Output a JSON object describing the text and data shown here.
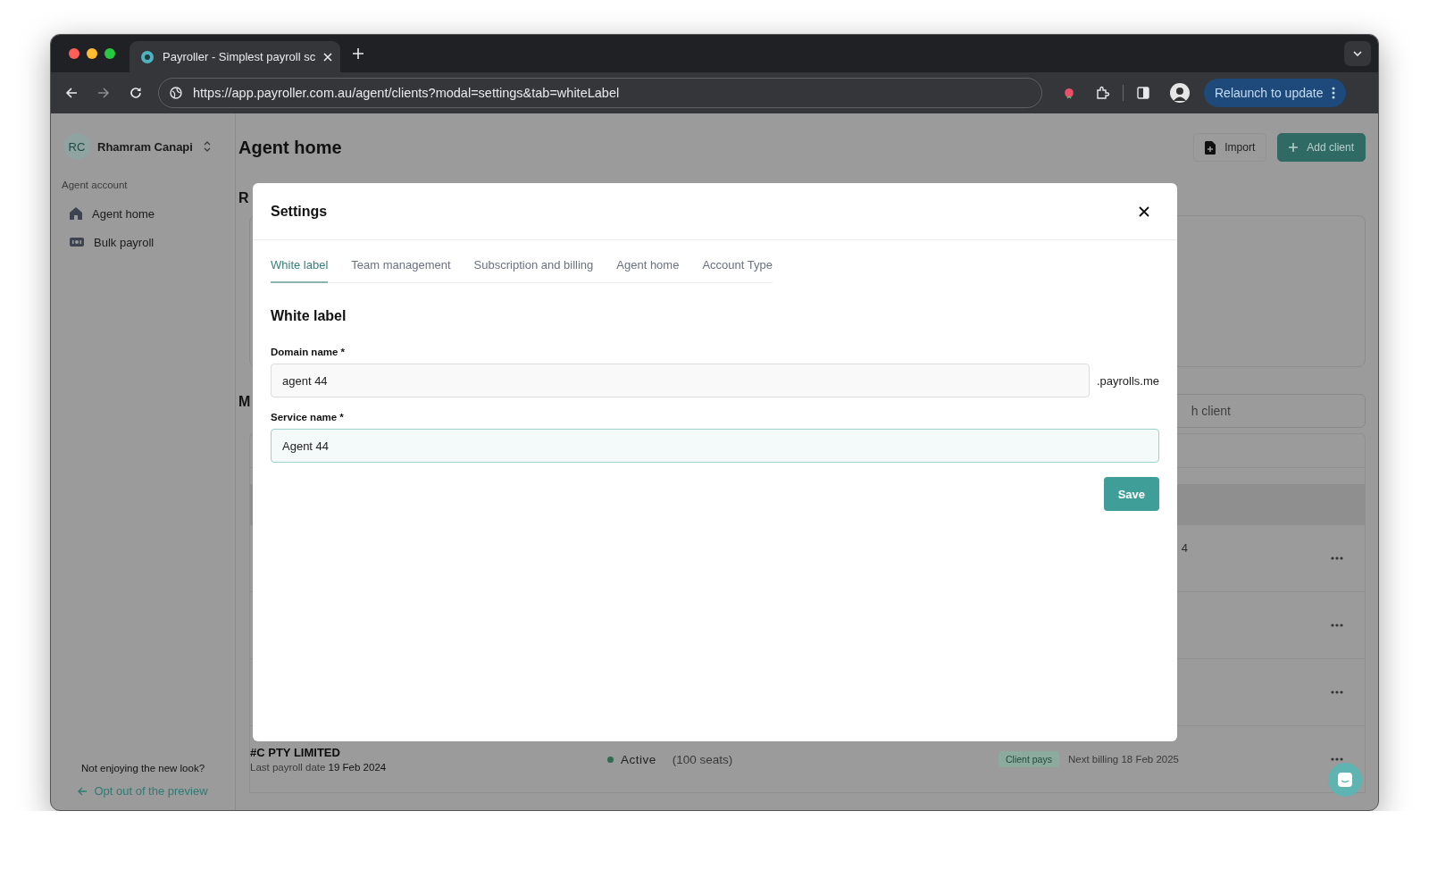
{
  "browser": {
    "tab_title": "Payroller - Simplest payroll sc",
    "url": "https://app.payroller.com.au/agent/clients?modal=settings&tab=whiteLabel",
    "relaunch": "Relaunch to update"
  },
  "sidebar": {
    "initials": "RC",
    "user_name": "Rhamram Canapi",
    "section": "Agent account",
    "items": [
      {
        "kind": "home",
        "label": "Agent home"
      },
      {
        "kind": "payroll",
        "label": "Bulk payroll"
      }
    ],
    "footer_note": "Not enjoying the new look?",
    "opt_out": "Opt out of the preview"
  },
  "page": {
    "title": "Agent home",
    "buttons": [
      {
        "kind": "import",
        "label": "Import"
      },
      {
        "kind": "add",
        "label": "Add client"
      }
    ],
    "section_1_fragment": "R",
    "section_2_fragment": "M",
    "search_fragment": "h client",
    "rows": [
      {
        "kind": "partial",
        "column_fragment": "4"
      },
      {
        "kind": "partial"
      },
      {
        "kind": "partial"
      },
      {
        "kind": "client",
        "name": "#C PTY LIMITED",
        "last_payroll_label": "Last payroll date",
        "last_payroll_date": "19 Feb 2024",
        "status": "Active",
        "seats": "(100 seats)",
        "tag": "Client pays",
        "next_billing": "Next billing 18 Feb 2025"
      }
    ]
  },
  "modal": {
    "title": "Settings",
    "tabs": [
      {
        "label": "White label",
        "selected": true
      },
      {
        "label": "Team management",
        "selected": false
      },
      {
        "label": "Subscription and billing",
        "selected": false
      },
      {
        "label": "Agent home",
        "selected": false
      },
      {
        "label": "Account Type",
        "selected": false
      }
    ],
    "section_title": "White label",
    "fields": [
      {
        "label": "Domain name *",
        "value": "agent 44",
        "suffix": ".payrolls.me",
        "focused": false
      },
      {
        "label": "Service name *",
        "value": "Agent 44",
        "focused": true
      }
    ],
    "save": "Save"
  }
}
